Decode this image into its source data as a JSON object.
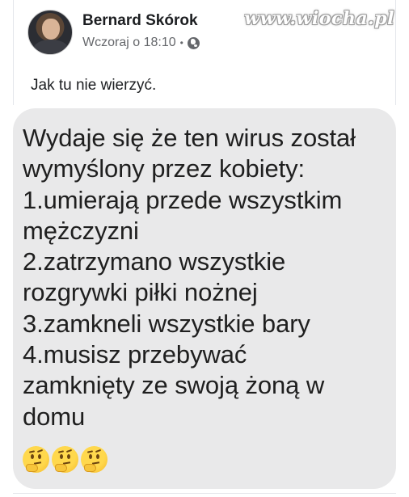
{
  "post": {
    "author": "Bernard Skórok",
    "timestamp": "Wczoraj o 18:10",
    "separator": "•",
    "privacy_icon": "globe-icon",
    "avatar_icon": "avatar",
    "text": "Jak tu nie wierzyć."
  },
  "watermark": {
    "text": "www.wiocha.pl"
  },
  "bubble": {
    "lines": [
      "Wydaje się że ten wirus został",
      "wymyślony przez kobiety:",
      "1.umierają przede wszystkim",
      "mężczyzni",
      "2.zatrzymano wszystkie",
      "rozgrywki piłki nożnej",
      "3.zamkneli wszystkie bary",
      "4.musisz przebywać",
      "zamknięty ze swoją żoną w",
      "domu"
    ],
    "emojis": [
      "thinking-face-icon",
      "thinking-face-icon",
      "thinking-face-icon"
    ]
  },
  "colors": {
    "bubble_background": "#e9e9ea",
    "author_text": "#1c1e21",
    "meta_text": "#65676b"
  }
}
